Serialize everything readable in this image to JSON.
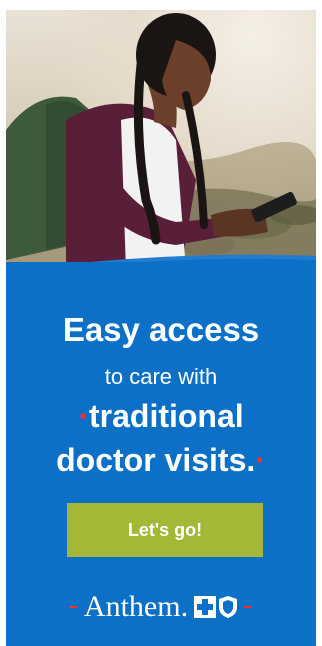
{
  "ad": {
    "headline": "Easy access",
    "subline": "to care with",
    "emphasis_line1": "traditional",
    "emphasis_line2": "doctor visits.",
    "cta_label": "Let's go!",
    "brand_name": "Anthem."
  },
  "colors": {
    "panel_blue": "#0d70c7",
    "cta_green": "#a4b736",
    "accent_red": "#e8342b",
    "text_white": "#ffffff"
  },
  "icons": [
    "cross-logo-icon",
    "shield-logo-icon"
  ]
}
